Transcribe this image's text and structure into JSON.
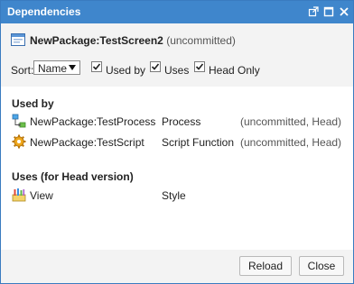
{
  "window": {
    "title": "Dependencies",
    "buttons": [
      "external-link-icon",
      "maximize-icon",
      "close-icon"
    ]
  },
  "header": {
    "item_name": "NewPackage:TestScreen2",
    "item_status": "(uncommitted)",
    "icon": "screen-icon"
  },
  "controls": {
    "sort_label": "Sort:",
    "sort_value": "Name",
    "used_by": {
      "label": "Used by",
      "checked": true
    },
    "uses": {
      "label": "Uses",
      "checked": true
    },
    "head_only": {
      "label": "Head Only",
      "checked": true
    }
  },
  "sections": {
    "used_by": {
      "title": "Used by",
      "rows": [
        {
          "name": "NewPackage:TestProcess",
          "type": "Process",
          "status": "(uncommitted, Head)",
          "icon": "process-icon"
        },
        {
          "name": "NewPackage:TestScript",
          "type": "Script Function",
          "status": "(uncommitted, Head)",
          "icon": "script-gear-icon"
        }
      ]
    },
    "uses": {
      "title": "Uses (for Head version)",
      "rows": [
        {
          "name": "View",
          "type": "Style",
          "icon": "style-palette-icon"
        }
      ]
    }
  },
  "footer": {
    "reload_label": "Reload",
    "close_label": "Close"
  },
  "colors": {
    "titlebar": "#3f86cc",
    "panel_bg": "#f3f3f3"
  }
}
